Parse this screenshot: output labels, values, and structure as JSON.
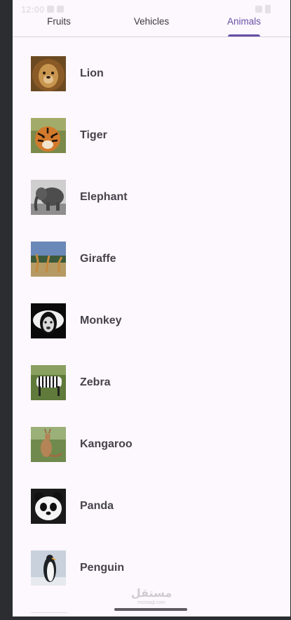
{
  "status_bar": {
    "time": "12:00"
  },
  "tabs": [
    {
      "label": "Fruits",
      "active": false
    },
    {
      "label": "Vehicles",
      "active": false
    },
    {
      "label": "Animals",
      "active": true
    }
  ],
  "animals": [
    {
      "name": "Lion",
      "icon": "lion-photo"
    },
    {
      "name": "Tiger",
      "icon": "tiger-photo"
    },
    {
      "name": "Elephant",
      "icon": "elephant-photo"
    },
    {
      "name": "Giraffe",
      "icon": "giraffe-photo"
    },
    {
      "name": "Monkey",
      "icon": "monkey-photo"
    },
    {
      "name": "Zebra",
      "icon": "zebra-photo"
    },
    {
      "name": "Kangaroo",
      "icon": "kangaroo-photo"
    },
    {
      "name": "Panda",
      "icon": "panda-photo"
    },
    {
      "name": "Penguin",
      "icon": "penguin-photo"
    }
  ],
  "watermark": {
    "main": "مستقل",
    "sub": "mostaql.com"
  },
  "colors": {
    "accent": "#6650a4",
    "background": "#fdf7fe",
    "text": "#46434b",
    "outer_frame": "#2b2d31"
  }
}
